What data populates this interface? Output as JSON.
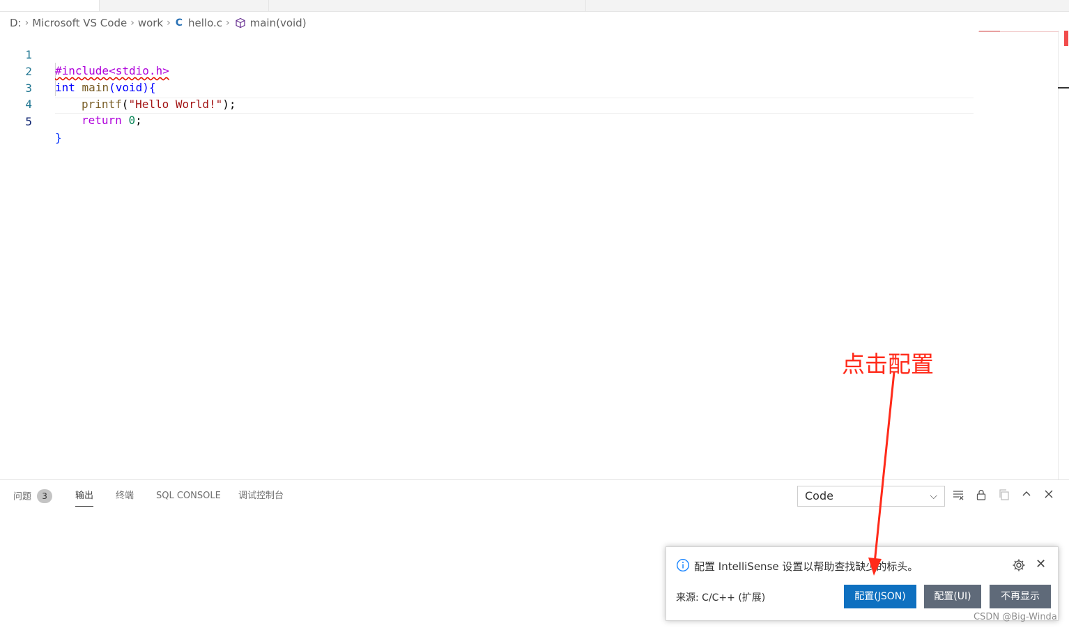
{
  "breadcrumb": {
    "drive": "D:",
    "folder1": "Microsoft VS Code",
    "folder2": "work",
    "file_icon": "C",
    "file": "hello.c",
    "symbol": "main(void)"
  },
  "code": {
    "lines": [
      {
        "num": "1",
        "include": "#include<stdio.h>"
      },
      {
        "num": "2",
        "kw": "int",
        "fn": "main",
        "open": "(",
        "kw2": "void",
        "rest": "){"
      },
      {
        "num": "3",
        "fn": "printf",
        "open": "(",
        "str": "\"Hello World!\"",
        "rest": ");"
      },
      {
        "num": "4",
        "kw": "return",
        "num_val": "0",
        "rest": ";"
      },
      {
        "num": "5",
        "close": "}"
      }
    ]
  },
  "panel": {
    "tabs": {
      "problems": "问题",
      "problems_count": "3",
      "output": "输出",
      "terminal": "终端",
      "sql_console": "SQL CONSOLE",
      "debug_console": "调试控制台"
    },
    "output_channel": "Code"
  },
  "notification": {
    "message": "配置 IntelliSense 设置以帮助查找缺少的标头。",
    "source": "来源: C/C++ (扩展)",
    "btn_json": "配置(JSON)",
    "btn_ui": "配置(UI)",
    "btn_dont_show": "不再显示"
  },
  "annotation": {
    "text": "点击配置",
    "color": "#ff2a1a"
  },
  "watermark": "CSDN @Big-Winda",
  "colors": {
    "primary_button": "#0e70c0",
    "secondary_button": "#5f6a79",
    "error_squiggle": "#e51400"
  }
}
